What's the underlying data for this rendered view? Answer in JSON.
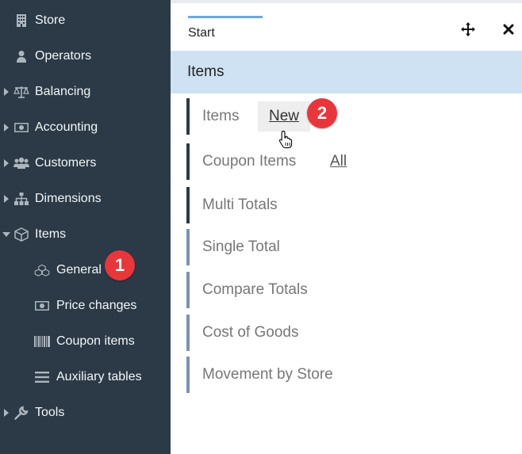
{
  "sidebar": {
    "items": [
      {
        "label": "Store",
        "icon": "building-icon"
      },
      {
        "label": "Operators",
        "icon": "user-icon"
      },
      {
        "label": "Balancing",
        "icon": "balance-scale-icon"
      },
      {
        "label": "Accounting",
        "icon": "money-bill-icon"
      },
      {
        "label": "Customers",
        "icon": "users-icon"
      },
      {
        "label": "Dimensions",
        "icon": "sitemap-icon"
      },
      {
        "label": "Items",
        "icon": "cube-icon"
      },
      {
        "label": "Tools",
        "icon": "wrench-icon"
      }
    ],
    "subitems": [
      {
        "label": "General",
        "icon": "cubes-icon"
      },
      {
        "label": "Price changes",
        "icon": "money-bill-icon"
      },
      {
        "label": "Coupon items",
        "icon": "barcode-icon"
      },
      {
        "label": "Auxiliary tables",
        "icon": "bars-icon"
      }
    ],
    "badge": "1"
  },
  "main": {
    "tab_label": "Start",
    "section_title": "Items",
    "rows": [
      {
        "label": "Items",
        "link": "New"
      },
      {
        "label": "Coupon Items",
        "link": "All"
      },
      {
        "label": "Multi Totals"
      },
      {
        "label": "Single Total"
      },
      {
        "label": "Compare Totals"
      },
      {
        "label": "Cost of Goods"
      },
      {
        "label": "Movement by Store"
      }
    ],
    "badge": "2"
  },
  "colors": {
    "sidebar_bg": "#2b3a46",
    "header_bg": "#cfe2f3",
    "badge": "#e8363b",
    "tab_accent": "#6fa8dc"
  }
}
